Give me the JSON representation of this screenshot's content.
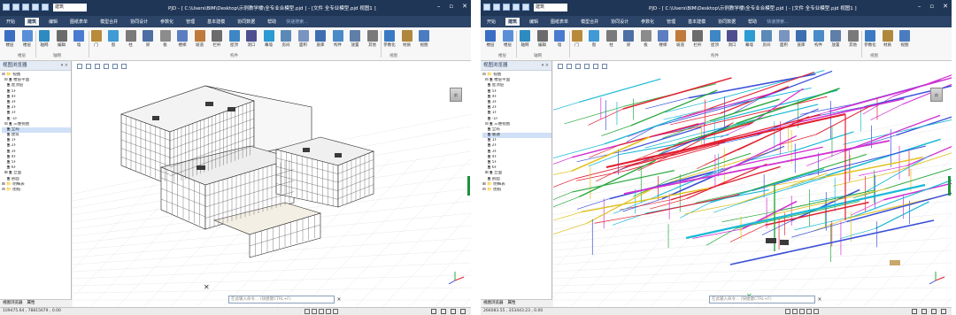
{
  "colors": {
    "titlebar": "#1f3657",
    "menubar": "#2b4468",
    "building_line": "#222222",
    "grid": "#d0d0d0",
    "pipe_red": "#e21f2f",
    "pipe_magenta": "#d22fd2",
    "pipe_blue": "#3a4fd8",
    "pipe_cyan": "#19b9d6",
    "pipe_green": "#28a83c",
    "pipe_yellow": "#e0c019"
  },
  "left": {
    "titlebar": {
      "project_combo": "建筑",
      "title": "PJD - [ C:\\Users\\BIM\\Desktop\\示例教学楼\\全专业合模型.pjd ] - [文件 全专业模型.pjd 视图1 ]",
      "min": "–",
      "max": "▫",
      "close": "✕"
    },
    "menu": {
      "tabs": [
        "开始",
        "建筑",
        "编辑",
        "图纸表单",
        "模型合并",
        "协同设计",
        "参数化",
        "管理",
        "基本建模",
        "协同数据",
        "帮助"
      ],
      "search": "快速搜索..."
    },
    "ribbon": {
      "buttons": [
        "楼层",
        "楼层",
        "轴网",
        "编辑",
        "墙",
        "门",
        "窗",
        "柱",
        "梁",
        "板",
        "楼梯",
        "坡道",
        "栏杆",
        "屋顶",
        "洞口",
        "幕墙",
        "房间",
        "面积",
        "族库",
        "构件",
        "放置",
        "其他",
        "参数化",
        "材质",
        "视图"
      ],
      "groups": [
        "楼层",
        "轴网",
        "构件",
        "视图"
      ]
    },
    "panel": {
      "title": "视图浏览器",
      "controls": "▾ × "
    },
    "tree": [
      "⊟ 📁 视图",
      "  ⊟ 🗎 楼层平面",
      "    🗎 屋顶层",
      "    🗎 5F",
      "    🗎 4F",
      "    🗎 3F",
      "    🗎 2F",
      "    🗎 1F",
      "    🗎 -1F",
      "  ⊟ 🗎 三维视图",
      "    🗎 全局",
      "    🗎 建筑",
      "    🗎 1F",
      "    🗎 2F",
      "    🗎 3F",
      "    🗎 4F",
      "    🗎 5F",
      "    🗎 6F",
      "  ⊞ 🗎 立面",
      "    🗎 剖面",
      "⊞ 📁 明细表",
      "⊟ 📁 图纸"
    ],
    "tree_selected_index": 10,
    "bottom_tabs": [
      "视图浏览器",
      "属性"
    ],
    "cube": "前",
    "command": "在此输入命令... (快捷键CTRL+F)",
    "status": "109475.64 , 78815679 , 0.00"
  },
  "right": {
    "titlebar": {
      "project_combo": "建筑",
      "title": "PJD - [ C:\\Users\\BIM\\Desktop\\示例教学楼\\全专业合模型.pjd ] - [文件 全专业模型.pjd 视图1 ]",
      "min": "–",
      "max": "▫",
      "close": "✕"
    },
    "menu": {
      "tabs": [
        "开始",
        "建筑",
        "编辑",
        "图纸表单",
        "模型合并",
        "协同设计",
        "参数化",
        "管理",
        "基本建模",
        "协同数据",
        "帮助"
      ],
      "search": "快速搜索..."
    },
    "ribbon": {
      "buttons": [
        "楼层",
        "楼层",
        "轴网",
        "编辑",
        "墙",
        "门",
        "窗",
        "柱",
        "梁",
        "板",
        "楼梯",
        "坡道",
        "栏杆",
        "屋顶",
        "洞口",
        "幕墙",
        "房间",
        "面积",
        "族库",
        "构件",
        "放置",
        "其他",
        "参数化",
        "材质",
        "视图"
      ],
      "groups": [
        "楼层",
        "轴网",
        "构件",
        "视图"
      ]
    },
    "panel": {
      "title": "视图浏览器",
      "controls": "▾ × "
    },
    "tree": [
      "⊟ 📁 视图",
      "  ⊟ 🗎 楼层平面",
      "    🗎 屋顶层",
      "    🗎 5F",
      "    🗎 4F",
      "    🗎 3F",
      "    🗎 2F",
      "    🗎 1F",
      "    🗎 -1F",
      "  ⊟ 🗎 三维视图",
      "    🗎 全局",
      "    🗎 暖通",
      "    🗎 1F",
      "    🗎 2F",
      "    🗎 3F",
      "    🗎 4F",
      "    🗎 5F",
      "    🗎 6F",
      "  ⊞ 🗎 立面",
      "    🗎 剖面",
      "⊞ 📁 明细表",
      "⊟ 📁 图纸"
    ],
    "tree_selected_index": 11,
    "bottom_tabs": [
      "视图浏览器",
      "属性"
    ],
    "cube": "前",
    "command": "在此输入命令... (快捷键CTRL+F)",
    "status": "266083.55 , 353443.23 , 0.00"
  }
}
